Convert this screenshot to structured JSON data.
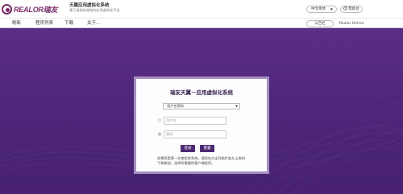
{
  "header": {
    "logo_text": "REALOR瑞友",
    "title": "天翼应用虚拟化系统",
    "subtitle": "基于虚拟化架构的应用虚拟化平台",
    "language": "中文简体",
    "help_label": "帮助台"
  },
  "nav": {
    "items": [
      "刷新",
      "程序列表",
      "下载",
      "关于..."
    ],
    "client_button": "公告栏",
    "brand": "Realor Online"
  },
  "login": {
    "title": "瑞友天翼－应用虚拟化系统",
    "account_type": "用户名密码",
    "username_placeholder": "用户名",
    "password_placeholder": "密码",
    "login_label": "登录",
    "reset_label": "重置",
    "notice": "如果您是第一次使用本系统，请您先点击导航栏处左上角的下载按钮，选择所需要的客户端程序。"
  },
  "colors": {
    "brand": "#7a2b6a",
    "background": "#5b2e86",
    "button": "#4b2a73",
    "panel_border": "#a58fc0"
  }
}
